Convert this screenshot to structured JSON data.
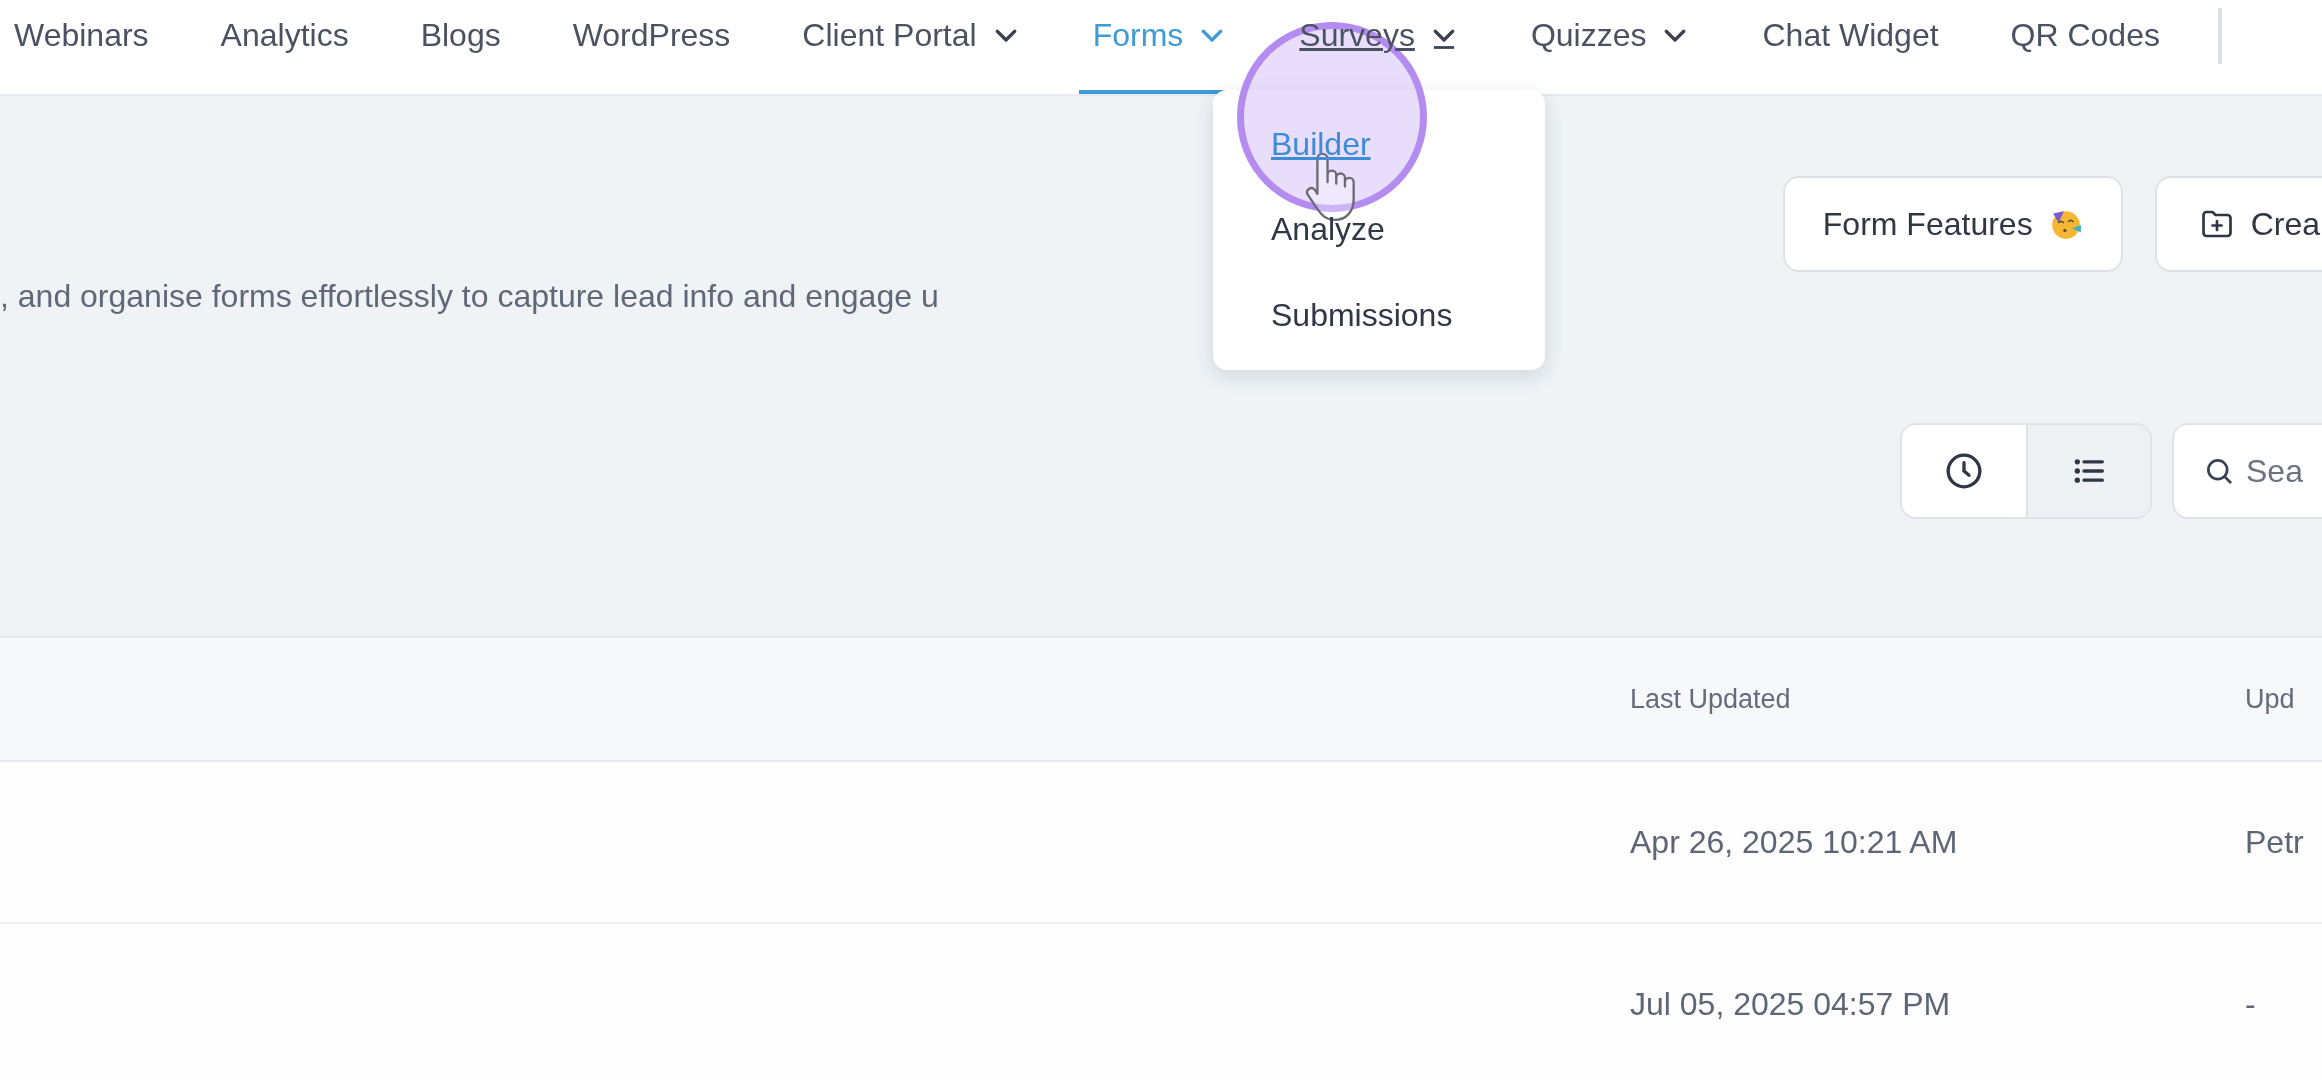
{
  "nav": {
    "items": [
      {
        "label": "Webinars",
        "dropdown": false,
        "selected": false,
        "hovered": false
      },
      {
        "label": "Analytics",
        "dropdown": false,
        "selected": false,
        "hovered": false
      },
      {
        "label": "Blogs",
        "dropdown": false,
        "selected": false,
        "hovered": false
      },
      {
        "label": "WordPress",
        "dropdown": false,
        "selected": false,
        "hovered": false
      },
      {
        "label": "Client Portal",
        "dropdown": true,
        "selected": false,
        "hovered": false
      },
      {
        "label": "Forms",
        "dropdown": true,
        "selected": true,
        "hovered": false
      },
      {
        "label": "Surveys",
        "dropdown": true,
        "selected": false,
        "hovered": true
      },
      {
        "label": "Quizzes",
        "dropdown": true,
        "selected": false,
        "hovered": false
      },
      {
        "label": "Chat Widget",
        "dropdown": false,
        "selected": false,
        "hovered": false
      },
      {
        "label": "QR Codes",
        "dropdown": false,
        "selected": false,
        "hovered": false
      }
    ]
  },
  "dropdown_menu": {
    "items": [
      {
        "label": "Builder",
        "selected": true
      },
      {
        "label": "Analyze",
        "selected": false
      },
      {
        "label": "Submissions",
        "selected": false
      }
    ]
  },
  "description": ", and organise forms effortlessly to capture lead info and engage u",
  "header_buttons": [
    {
      "kind": "features",
      "label": "Form Features"
    },
    {
      "kind": "create",
      "label": "Crea"
    }
  ],
  "view_toggle": [
    {
      "kind": "clock",
      "selected": false
    },
    {
      "kind": "list",
      "selected": true
    }
  ],
  "search": {
    "placeholder": "Sea"
  },
  "table": {
    "columns": [
      "Last Updated",
      "Upd"
    ],
    "rows": [
      {
        "cells": [
          "Apr 26, 2025 10:21 AM",
          "Petr"
        ]
      },
      {
        "cells": [
          "Jul 05, 2025 04:57 PM",
          "-"
        ]
      }
    ]
  }
}
